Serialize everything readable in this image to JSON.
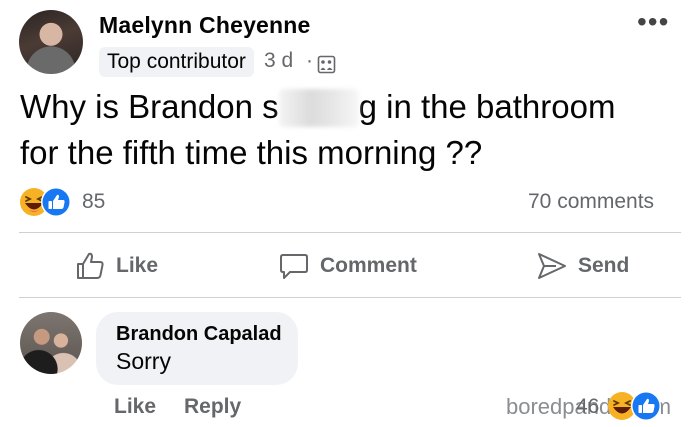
{
  "post": {
    "author": "Maelynn Cheyenne",
    "badge": "Top contributor",
    "time": "3 d",
    "separator": "·",
    "more": "•••",
    "text_line1_start": "Why is Brandon s",
    "text_line1_end": "g in the bathroom",
    "text_line2": "for the fifth time this morning ??"
  },
  "stats": {
    "reaction_icons": [
      "laugh-reaction-icon",
      "like-reaction-icon"
    ],
    "reaction_count": "85",
    "comments": "70 comments"
  },
  "actions": {
    "like": "Like",
    "comment": "Comment",
    "send": "Send"
  },
  "comment": {
    "author": "Brandon Capalad",
    "text": "Sorry",
    "like": "Like",
    "reply": "Reply",
    "reaction_count": "46",
    "reaction_icons": [
      "laugh-reaction-icon",
      "like-reaction-icon"
    ]
  },
  "watermark": "boredpanda.com",
  "colors": {
    "like_blue": "#1877f2",
    "laugh_yellow": "#f7b125",
    "muted_text": "#65676b",
    "bubble_bg": "#f0f2f5"
  }
}
